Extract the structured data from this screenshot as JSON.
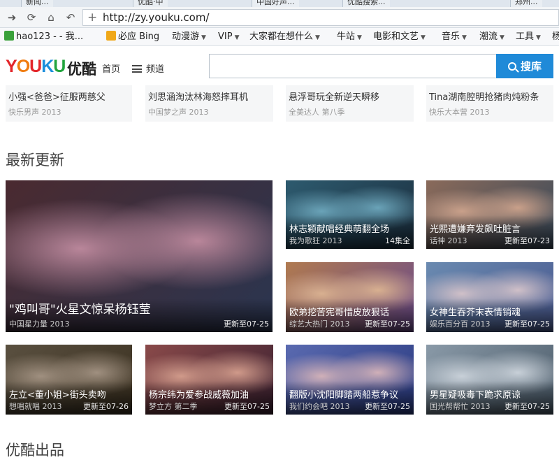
{
  "browser": {
    "address": "http://zy.youku.com/",
    "tabs": [
      "新闻...",
      "优酷·中",
      "中国好声...",
      "优酷搜索...",
      "郑州..."
    ],
    "bookmarks": [
      {
        "label": "hao123 - - 我...",
        "color": "#3aa13a"
      },
      {
        "label": "必应 Bing",
        "color": "#f0a818"
      },
      {
        "label": "动漫游",
        "dropdown": true
      },
      {
        "label": "VIP",
        "dropdown": true
      },
      {
        "label": "大家都在想什么",
        "dropdown": true
      },
      {
        "label": "牛站",
        "dropdown": true
      },
      {
        "label": "电影和文艺",
        "dropdown": true
      },
      {
        "label": "音乐",
        "dropdown": true
      },
      {
        "label": "潮流",
        "dropdown": true
      },
      {
        "label": "工具",
        "dropdown": true
      },
      {
        "label": "杨"
      }
    ]
  },
  "header": {
    "logo_en": "YOUKU",
    "logo_cn": "优酷",
    "nav_home": "首页",
    "nav_channels": "频道",
    "search_placeholder": "",
    "search_button": "搜库"
  },
  "prev_row": [
    {
      "title": "小强<爸爸>征服两慈父",
      "sub": "快乐男声 2013"
    },
    {
      "title": "刘思涵淘汰林海怒摔耳机",
      "sub": "中国梦之声 2013"
    },
    {
      "title": "悬浮哥玩全新逆天瞬移",
      "sub": "全美达人 第八季"
    },
    {
      "title": "Tina湖南腔明抢猪肉炖粉条",
      "sub": "快乐大本营 2013"
    }
  ],
  "section_title": "最新更新",
  "next_section_title": "优酷出品",
  "videos": [
    {
      "title": "\"鸡叫哥\"火星文惊呆杨钰莹",
      "show": "中国星力量 2013",
      "update": "更新至07-25",
      "colors": [
        "#4a2a30",
        "#b9869a",
        "#2a3550"
      ]
    },
    {
      "title": "林志颖献唱经典萌翻全场",
      "show": "我为歌狂 2013",
      "update": "14集全",
      "colors": [
        "#2d5a6e",
        "#6aa3b8",
        "#1c3040"
      ]
    },
    {
      "title": "光熙遭嫌弃发飙吐脏言",
      "show": "话神 2013",
      "update": "更新至07-23",
      "colors": [
        "#8a6a5a",
        "#c9a08a",
        "#3a4a5a"
      ]
    },
    {
      "title": "欧弟挖苦宪哥惜皮放狠话",
      "show": "综艺大热门 2013",
      "update": "更新至07-25",
      "colors": [
        "#b07a50",
        "#d8b090",
        "#6a4a8a"
      ]
    },
    {
      "title": "女神生吞芥末表情销魂",
      "show": "娱乐百分百 2013",
      "update": "更新至07-25",
      "colors": [
        "#6a8ab0",
        "#d0c0c8",
        "#4a5a90"
      ]
    },
    {
      "title": "左立<董小姐>街头卖吻",
      "show": "想唱就唱 2013",
      "update": "更新至07-26",
      "colors": [
        "#5a5040",
        "#a09080",
        "#3a3020"
      ]
    },
    {
      "title": "杨宗纬为爱参战威薇加油",
      "show": "梦立方 第二季",
      "update": "更新至07-25",
      "colors": [
        "#8a4a4a",
        "#d09a8a",
        "#3a2030"
      ]
    },
    {
      "title": "翻版小沈阳脚踏两船惹争议",
      "show": "我们约会吧 2013",
      "update": "更新至07-25",
      "colors": [
        "#5a6ab0",
        "#d0b0b8",
        "#2a3a80"
      ]
    },
    {
      "title": "男星疑吸毒下跪求原谅",
      "show": "国光帮帮忙 2013",
      "update": "更新至07-25",
      "colors": [
        "#8a9aa8",
        "#c8d0d8",
        "#4a5a68"
      ]
    }
  ]
}
